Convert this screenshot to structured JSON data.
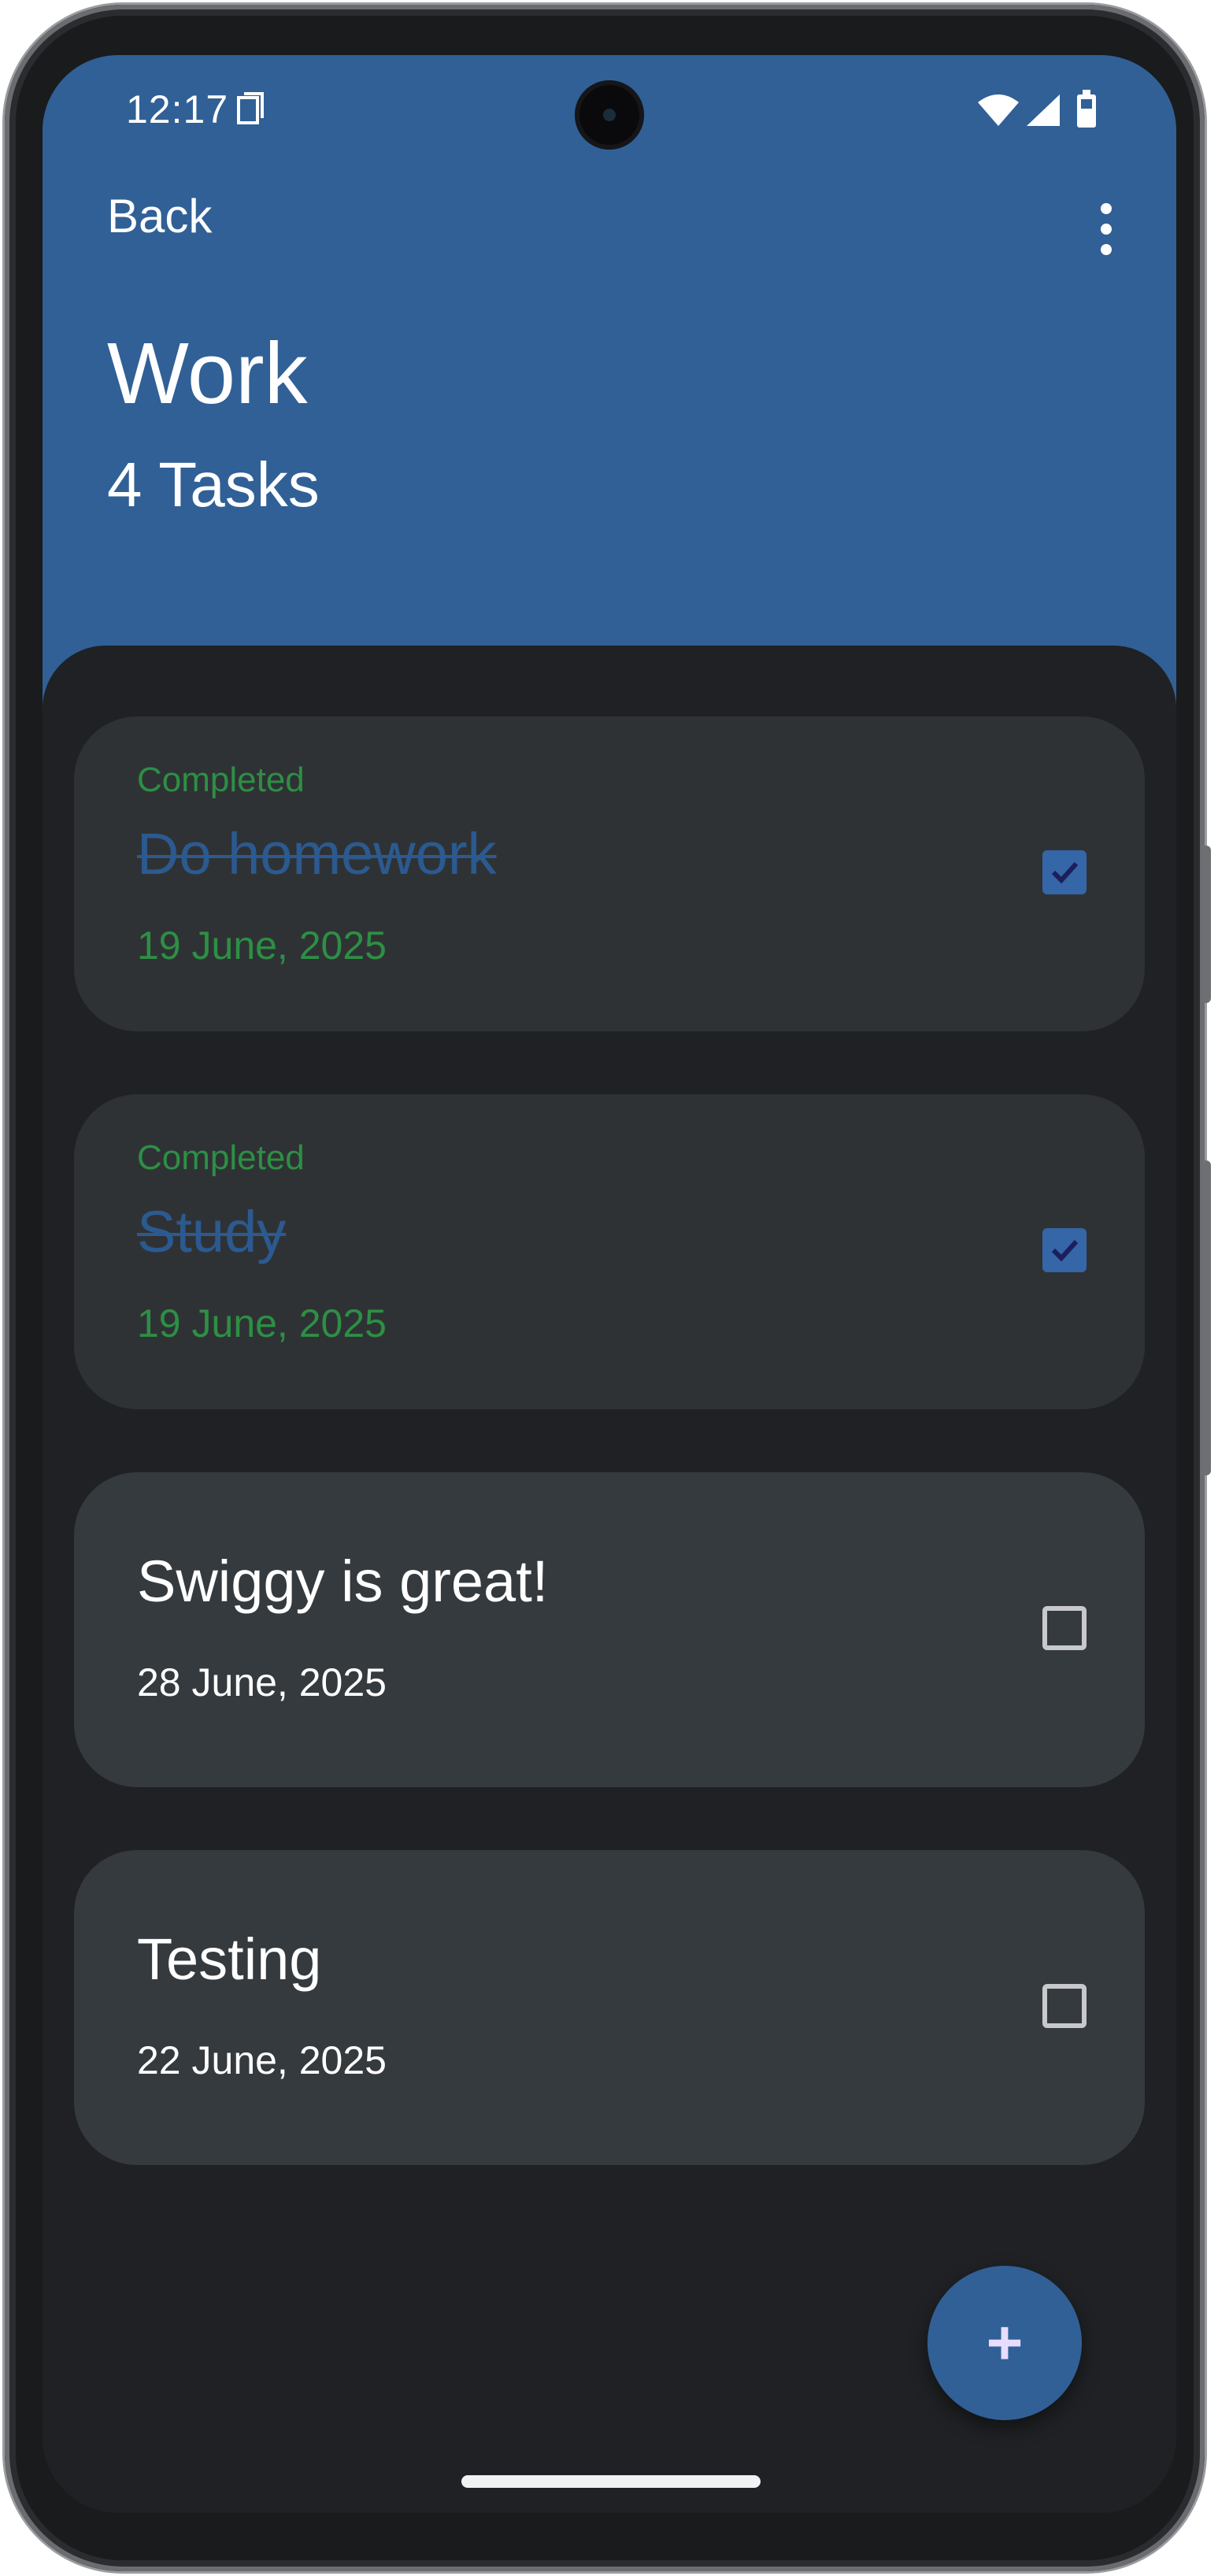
{
  "status_bar": {
    "time": "12:17",
    "icons": [
      "screen-record-icon",
      "wifi-icon",
      "signal-icon",
      "battery-icon"
    ]
  },
  "header": {
    "back_label": "Back",
    "menu_icon": "more-vert-icon",
    "title": "Work",
    "subtitle": "4 Tasks"
  },
  "tasks": [
    {
      "status": "Completed",
      "title": "Do homework",
      "date": "19 June, 2025",
      "checked": true
    },
    {
      "status": "Completed",
      "title": "Study",
      "date": "19 June, 2025",
      "checked": true
    },
    {
      "status": "",
      "title": "Swiggy is great!",
      "date": "28 June, 2025",
      "checked": false
    },
    {
      "status": "",
      "title": "Testing",
      "date": "22 June, 2025",
      "checked": false
    }
  ],
  "fab": {
    "label": "+",
    "icon": "add-icon"
  },
  "colors": {
    "header": "#306096",
    "background": "#1f2124",
    "card": "#2f3235",
    "completed_text": "#2d8f44",
    "checkbox_checked": "#3466a8"
  }
}
